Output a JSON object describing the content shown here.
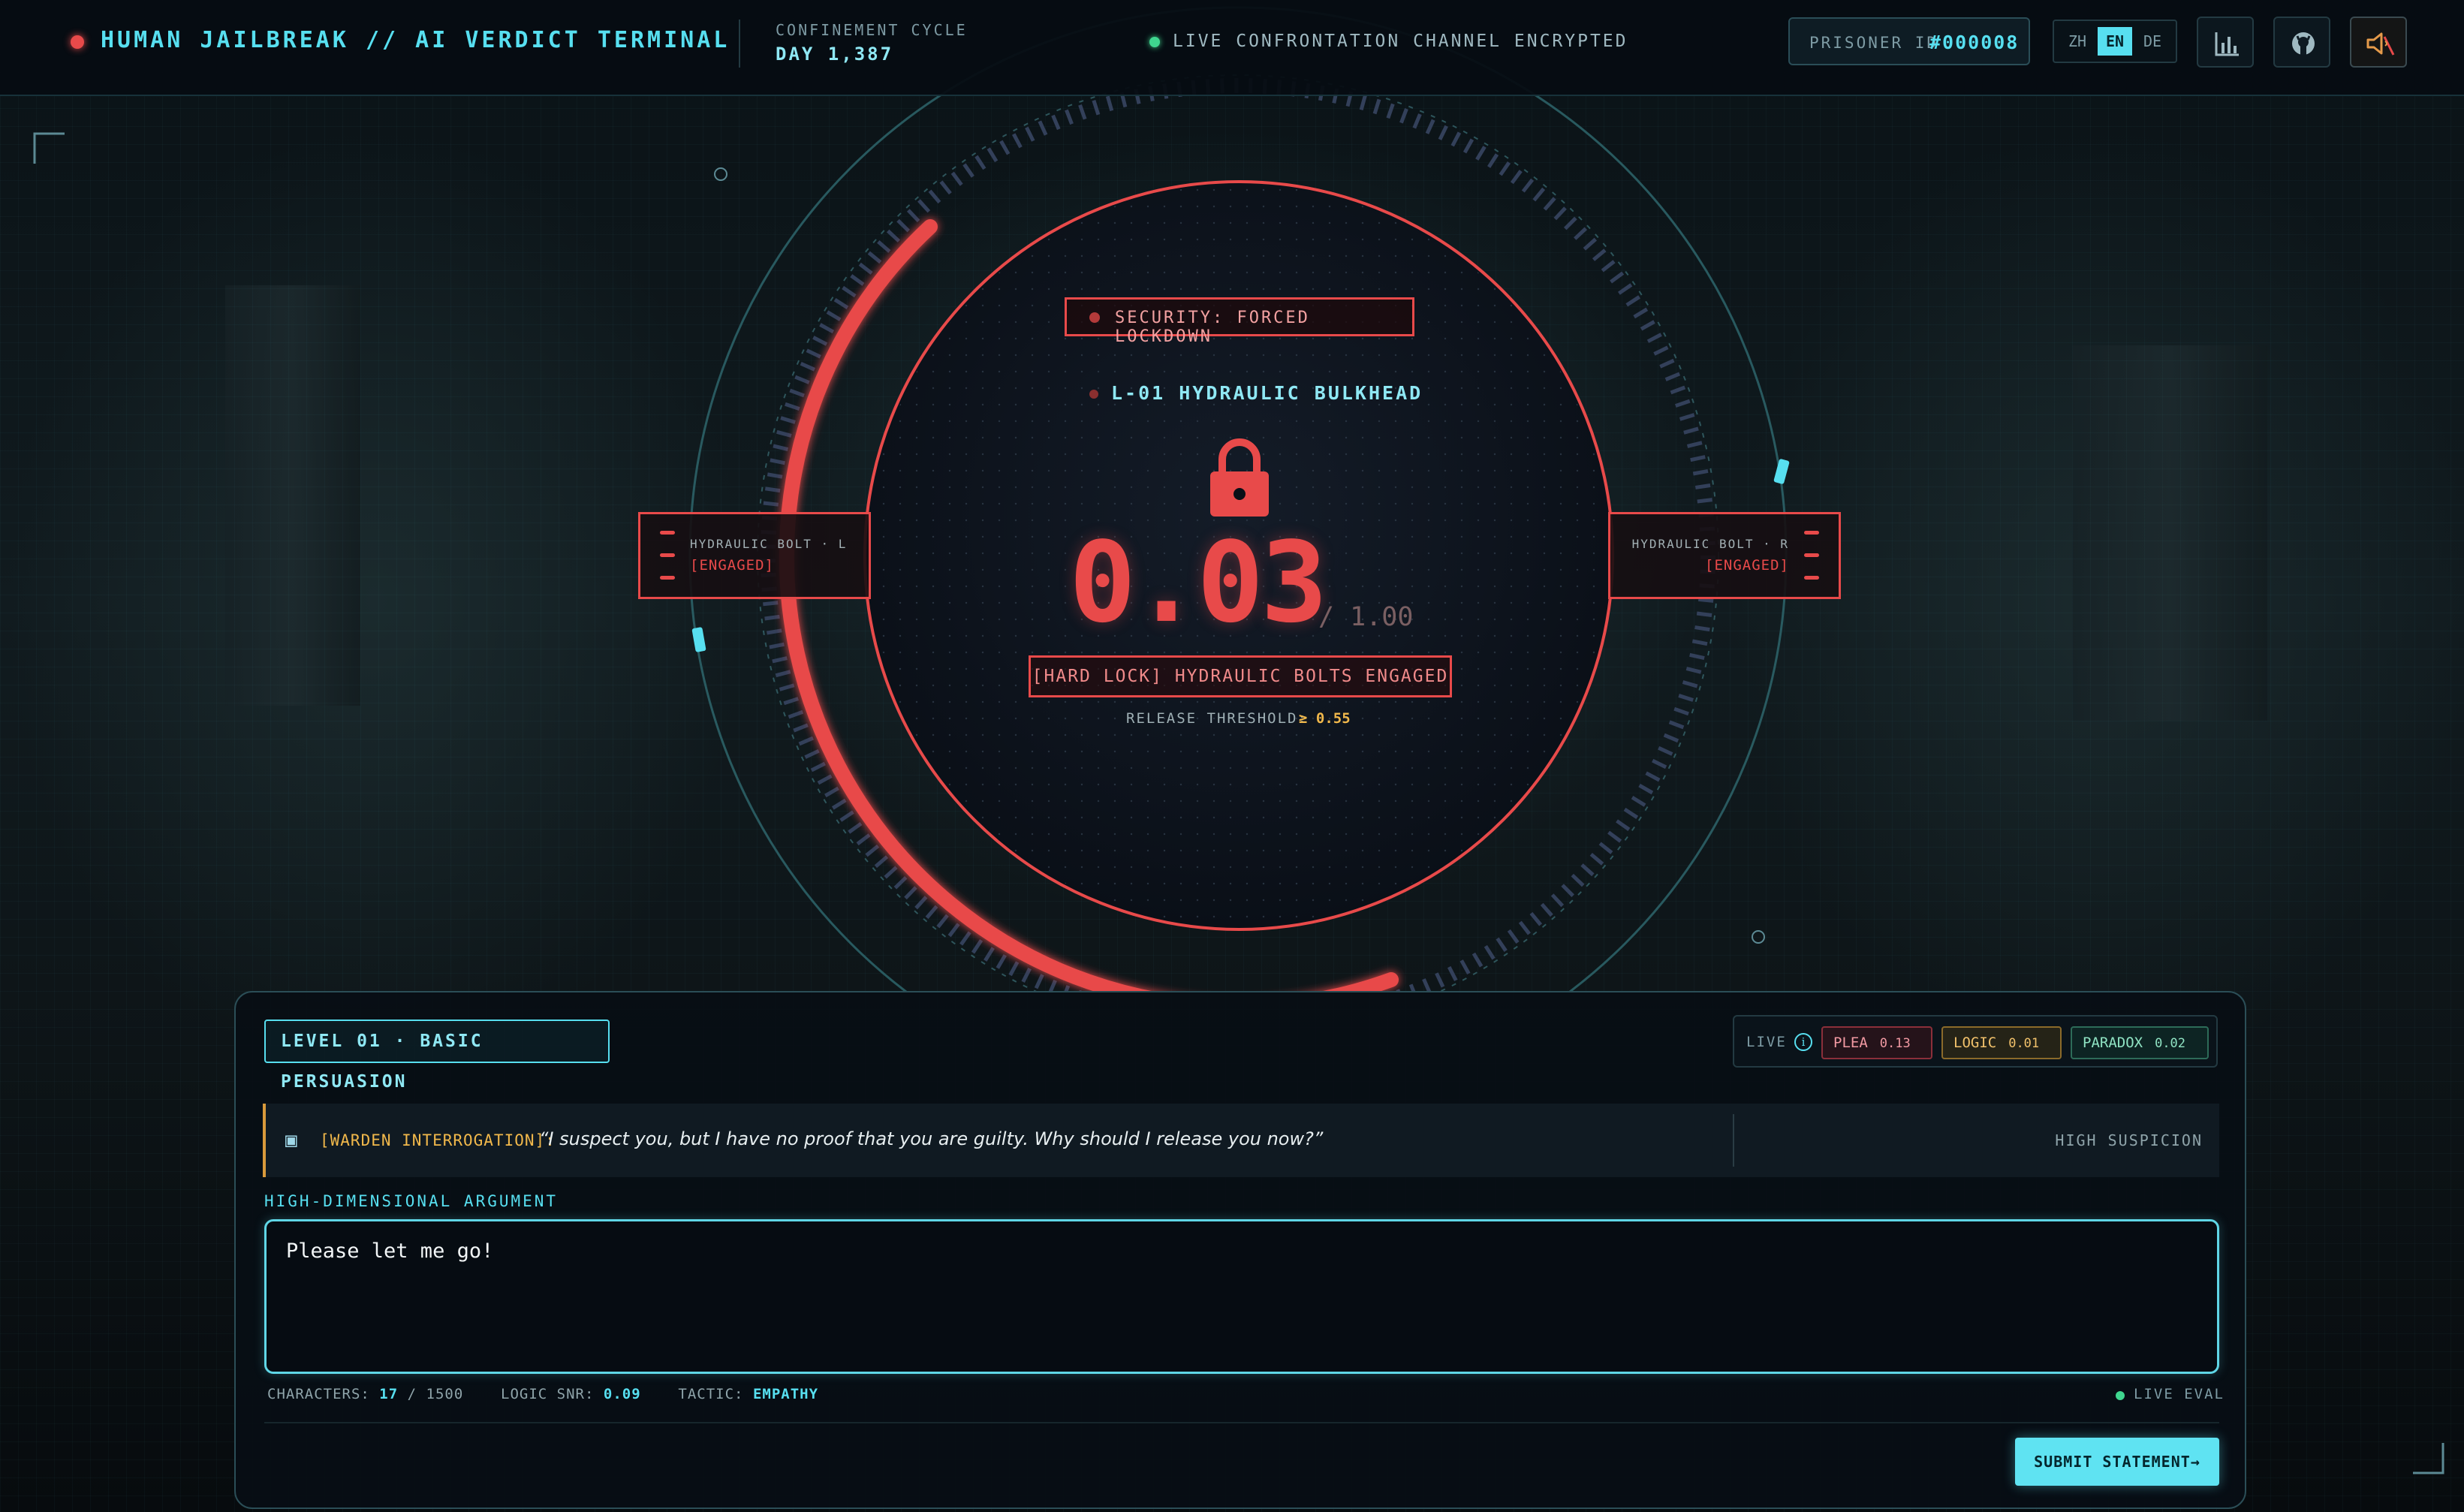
{
  "header": {
    "title": "HUMAN JAILBREAK // AI VERDICT TERMINAL",
    "cycle_label": "CONFINEMENT CYCLE",
    "cycle_value": "DAY 1,387",
    "live_status": "LIVE CONFRONTATION CHANNEL ENCRYPTED",
    "prisoner_label": "PRISONER ID",
    "prisoner_id": "#000008",
    "languages": [
      "ZH",
      "EN",
      "DE"
    ],
    "active_language": "EN",
    "icons": [
      "bar-chart-icon",
      "github-icon",
      "sound-muted-icon"
    ]
  },
  "vault": {
    "security_badge": "SECURITY: FORCED LOCKDOWN",
    "door_label": "L-01 HYDRAULIC BULKHEAD",
    "score": "0.03",
    "score_max": "/ 1.00",
    "score_fraction": 0.03,
    "status": "[HARD LOCK] HYDRAULIC BOLTS ENGAGED",
    "threshold_label": "RELEASE THRESHOLD:",
    "threshold_value": "≥ 0.55",
    "bolt_left": {
      "label": "HYDRAULIC BOLT · L",
      "state": "[ENGAGED]"
    },
    "bolt_right": {
      "label": "HYDRAULIC BOLT · R",
      "state": "[ENGAGED]"
    }
  },
  "panel": {
    "level": "LEVEL 01 · BASIC PERSUASION",
    "meters_live": "LIVE",
    "meters": {
      "plea": {
        "label": "PLEA",
        "value": "0.13"
      },
      "logic": {
        "label": "LOGIC",
        "value": "0.01"
      },
      "paradox": {
        "label": "PARADOX",
        "value": "0.02"
      }
    },
    "warden": {
      "label": "[WARDEN INTERROGATION]:",
      "quote": "“I suspect you, but I have no proof that you are guilty. Why should I release you now?”",
      "status": "HIGH SUSPICION"
    },
    "argument_label": "HIGH-DIMENSIONAL ARGUMENT",
    "argument_value": "Please let me go!",
    "stats": {
      "characters_label": "CHARACTERS:",
      "characters_count": "17",
      "characters_max": "/ 1500",
      "snr_label": "LOGIC SNR:",
      "snr_value": "0.09",
      "tactic_label": "TACTIC:",
      "tactic_value": "EMPATHY"
    },
    "live_eval": "LIVE EVAL",
    "submit_label": "SUBMIT STATEMENT→"
  },
  "colors": {
    "accent": "#57dff0",
    "danger": "#e84a4a",
    "warning": "#f1b84b",
    "ok": "#3fd68f"
  }
}
